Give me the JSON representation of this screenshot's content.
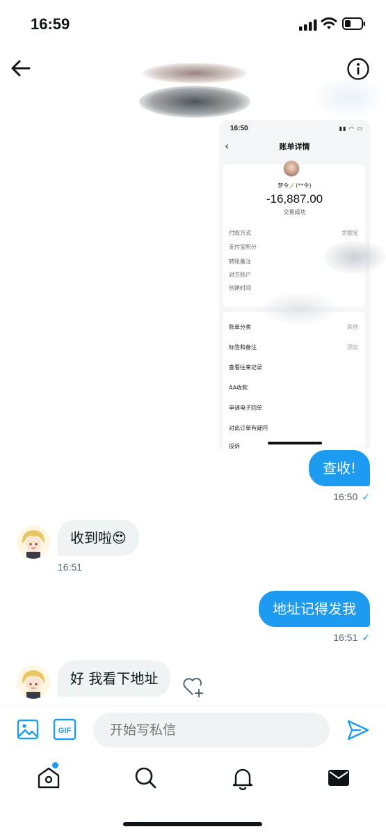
{
  "status_bar": {
    "time": "16:59"
  },
  "header": {},
  "image_message": {
    "status_time": "16:50",
    "nav_title": "账单详情",
    "payee_name": "梦令🪄(**令)",
    "amount": "-16,887.00",
    "status": "交易成功",
    "details": [
      {
        "label": "付款方式",
        "value": "余额宝"
      },
      {
        "label": "支付宝积分",
        "value": ""
      },
      {
        "label": "转账备注",
        "value": ""
      },
      {
        "label": "对方账户",
        "value": ""
      },
      {
        "label": "创建时间",
        "value": ""
      }
    ],
    "list": [
      {
        "label": "账单分类",
        "value": "其他"
      },
      {
        "label": "标签和备注",
        "value": "添加"
      },
      {
        "label": "查看往来记录",
        "value": ""
      },
      {
        "label": "AA收款",
        "value": ""
      },
      {
        "label": "申请电子回单",
        "value": ""
      },
      {
        "label": "对此订单有疑问",
        "value": ""
      },
      {
        "label": "投诉",
        "value": ""
      }
    ]
  },
  "messages": [
    {
      "text": "查收!",
      "time": "16:50"
    },
    {
      "text": "收到啦😍",
      "time": "16:51"
    },
    {
      "text": "地址记得发我",
      "time": "16:51"
    },
    {
      "text": "好 我看下地址"
    }
  ],
  "composer": {
    "placeholder": "开始写私信"
  },
  "colors": {
    "accent": "#1d9bf0",
    "incoming_bubble": "#eff3f4",
    "text": "#0f1419",
    "muted": "#536471"
  },
  "icons": [
    "back-arrow-icon",
    "info-icon",
    "heart-plus-icon",
    "image-icon",
    "gif-icon",
    "send-icon",
    "home-icon",
    "search-icon",
    "bell-icon",
    "mail-icon"
  ]
}
